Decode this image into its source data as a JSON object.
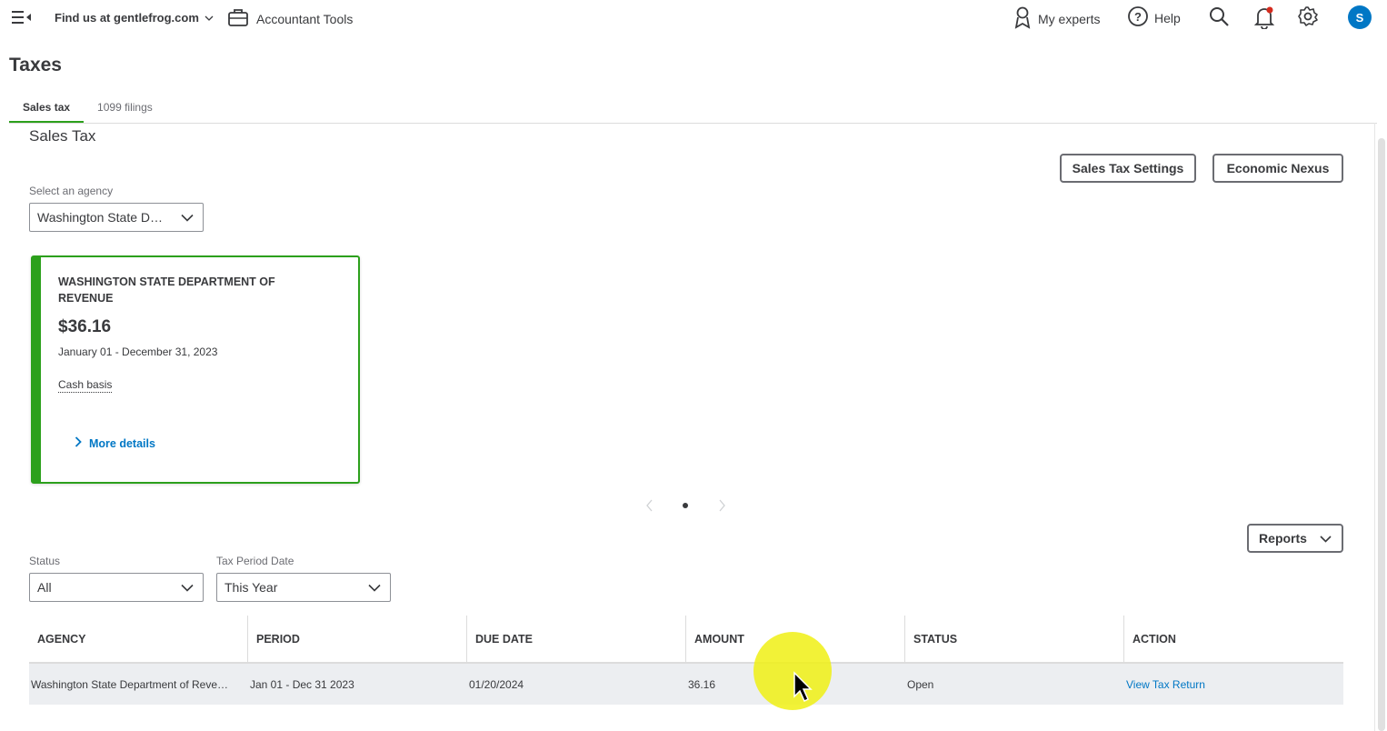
{
  "topbar": {
    "company_label": "Find us at gentlefrog.com",
    "tools_label": "Accountant Tools",
    "experts_label": "My experts",
    "help_label": "Help",
    "avatar_initial": "S"
  },
  "page": {
    "title": "Taxes",
    "tabs": [
      {
        "label": "Sales tax",
        "active": true
      },
      {
        "label": "1099 filings",
        "active": false
      }
    ]
  },
  "sales_tax": {
    "section_title": "Sales Tax",
    "settings_button": "Sales Tax Settings",
    "nexus_button": "Economic Nexus",
    "agency_label": "Select an agency",
    "agency_value": "Washington State D…",
    "card": {
      "agency": "WASHINGTON STATE DEPARTMENT OF REVENUE",
      "amount": "$36.16",
      "period": "January 01 - December 31, 2023",
      "basis": "Cash basis",
      "more_details": "More details"
    },
    "reports_button": "Reports",
    "filters": {
      "status_label": "Status",
      "status_value": "All",
      "period_label": "Tax Period Date",
      "period_value": "This Year"
    },
    "table": {
      "headers": [
        "AGENCY",
        "PERIOD",
        "DUE DATE",
        "AMOUNT",
        "STATUS",
        "ACTION"
      ],
      "rows": [
        {
          "agency": "Washington State Department of Reve…",
          "period": "Jan 01 - Dec 31 2023",
          "due_date": "01/20/2024",
          "amount": "36.16",
          "status": "Open",
          "action": "View Tax Return"
        }
      ]
    }
  },
  "colors": {
    "accent_green": "#2ca01c",
    "link_blue": "#0077c5",
    "text": "#393a3d"
  }
}
